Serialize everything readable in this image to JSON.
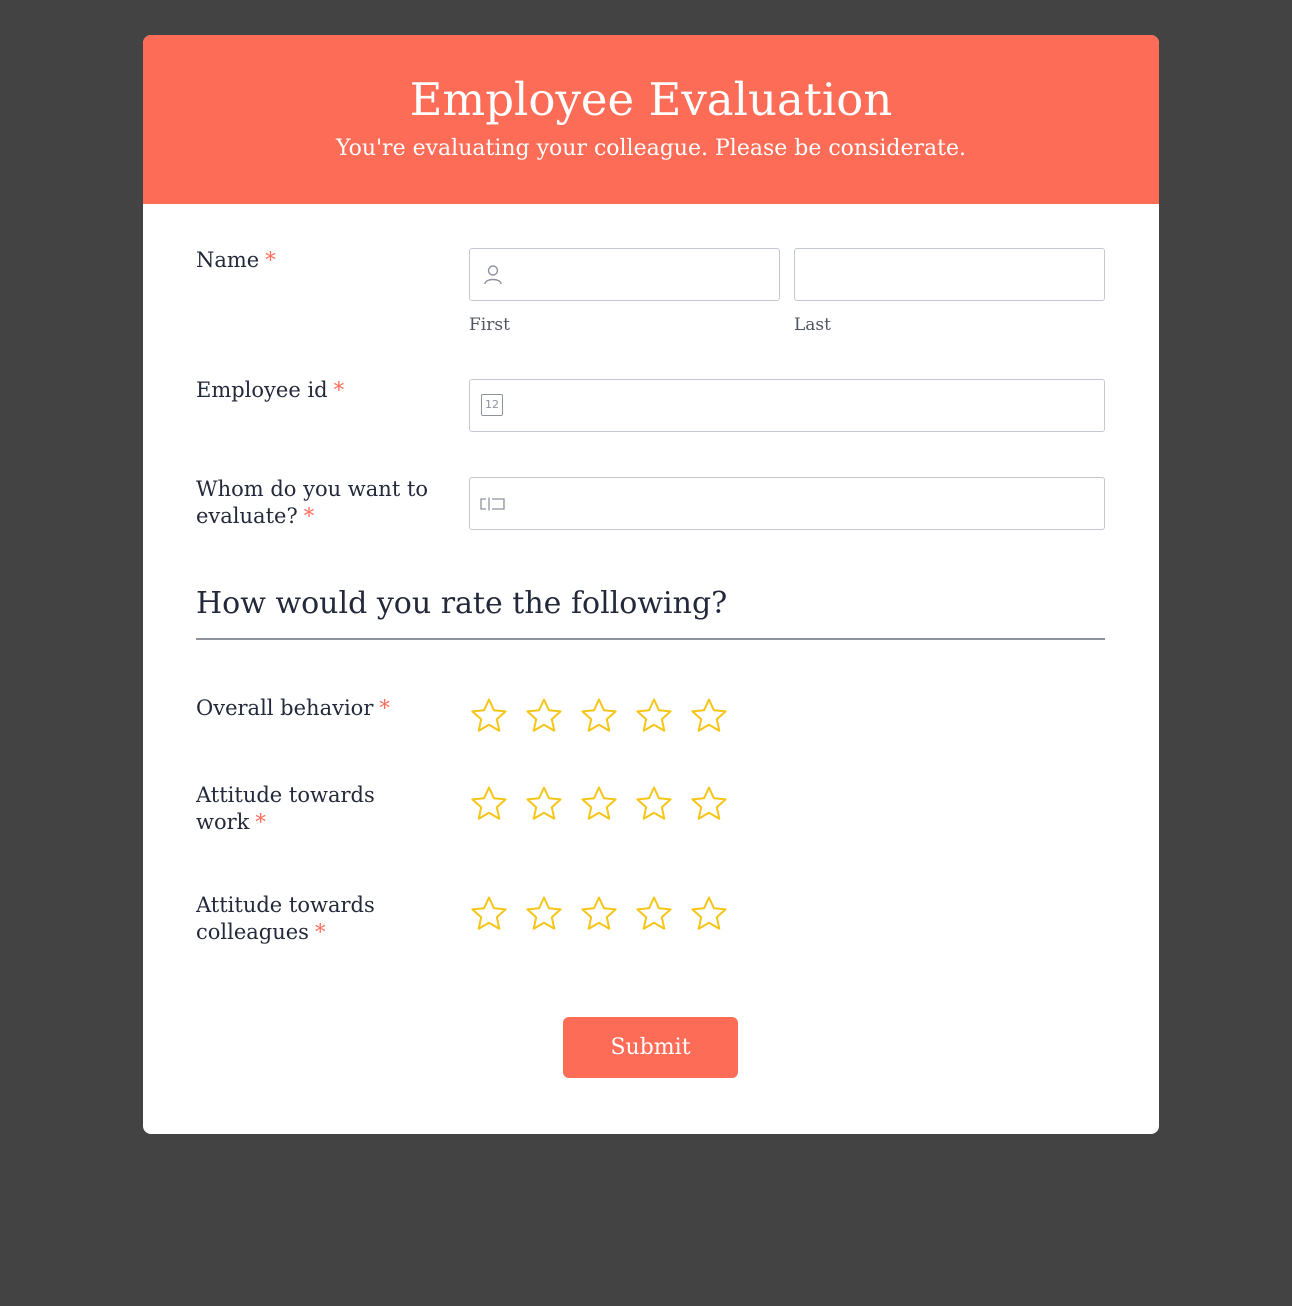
{
  "header": {
    "title": "Employee Evaluation",
    "subtitle": "You're evaluating your colleague. Please be considerate."
  },
  "required_marker": "*",
  "fields": {
    "name": {
      "label": "Name",
      "first_sublabel": "First",
      "last_sublabel": "Last",
      "first_value": "",
      "last_value": "",
      "icon": "person-icon"
    },
    "employee_id": {
      "label": "Employee id",
      "value": "",
      "icon": "number-icon",
      "icon_text": "12"
    },
    "evaluatee": {
      "label": "Whom do you want to evaluate?",
      "value": "",
      "icon": "text-input-icon"
    }
  },
  "rating_section": {
    "heading": "How would you rate the following?",
    "max_stars": 5,
    "items": [
      {
        "label": "Overall behavior",
        "rating": 0
      },
      {
        "label": "Attitude towards work",
        "rating": 0
      },
      {
        "label": "Attitude towards colleagues",
        "rating": 0
      }
    ]
  },
  "submit_label": "Submit",
  "colors": {
    "accent": "#fd6c57",
    "star": "#f5c518",
    "background": "#434343",
    "text": "#23293a"
  }
}
